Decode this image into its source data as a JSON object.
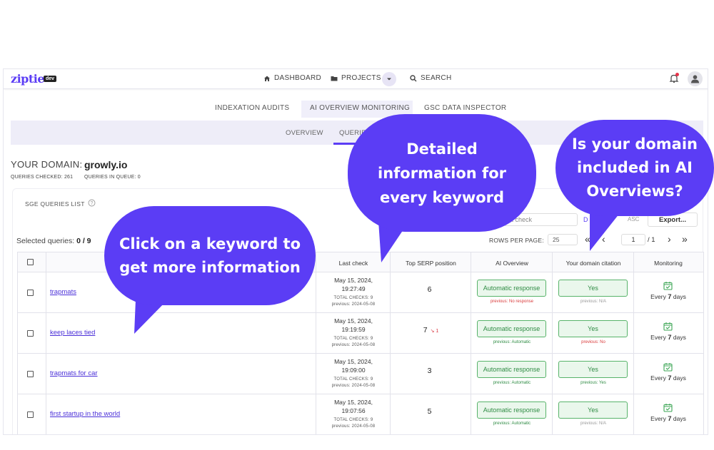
{
  "app": {
    "logo": "ziptie",
    "badge": "dev"
  },
  "topnav": {
    "dashboard": "DASHBOARD",
    "projects": "PROJECTS",
    "search": "SEARCH"
  },
  "tabs": [
    "INDEXATION AUDITS",
    "AI OVERVIEW MONITORING",
    "GSC DATA INSPECTOR"
  ],
  "subtabs": [
    "OVERVIEW",
    "QUERIES"
  ],
  "domain": {
    "label": "YOUR DOMAIN:",
    "value": "growly.io"
  },
  "stats": {
    "checked": "QUERIES CHECKED:  261",
    "queue": "QUERIES IN QUEUE:  0"
  },
  "card": {
    "title": "SGE QUERIES LIST",
    "selected_label": "Selected queries:",
    "selected_value": "0 / 9",
    "sort_value": "st check",
    "desc": "D",
    "asc": "ASC",
    "export": "Export...",
    "rows_per_page_label": "ROWS PER PAGE:",
    "rows_per_page": "25",
    "page": "1",
    "page_total": "/ 1"
  },
  "columns": [
    "Last check",
    "Top SERP position",
    "AI Overview",
    "Your domain citation",
    "Monitoring"
  ],
  "rows": [
    {
      "keyword": "trapmats",
      "date": "May 15, 2024,",
      "time": "19:27:49",
      "checks": "TOTAL CHECKS: 9",
      "prev_date": "previous: 2024-05-08",
      "serp": "6",
      "serp_change": "",
      "ai": "Automatic response",
      "ai_prev": "previous: No response",
      "ai_prev_color": "red",
      "cite": "Yes",
      "cite_prev": "previous: N/A",
      "cite_prev_color": "grey",
      "mon_pre": "Every ",
      "mon_num": "7",
      "mon_post": " days"
    },
    {
      "keyword": "keep laces tied",
      "date": "May 15, 2024,",
      "time": "19:19:59",
      "checks": "TOTAL CHECKS: 9",
      "prev_date": "previous: 2024-05-08",
      "serp": "7",
      "serp_change": "↘ 1",
      "ai": "Automatic response",
      "ai_prev": "previous: Automatic",
      "ai_prev_color": "green",
      "cite": "Yes",
      "cite_prev": "previous: No",
      "cite_prev_color": "red",
      "mon_pre": "Every ",
      "mon_num": "7",
      "mon_post": " days"
    },
    {
      "keyword": "trapmats for car",
      "date": "May 15, 2024,",
      "time": "19:09:00",
      "checks": "TOTAL CHECKS: 9",
      "prev_date": "previous: 2024-05-08",
      "serp": "3",
      "serp_change": "",
      "ai": "Automatic response",
      "ai_prev": "previous: Automatic",
      "ai_prev_color": "green",
      "cite": "Yes",
      "cite_prev": "previous: Yes",
      "cite_prev_color": "green",
      "mon_pre": "Every ",
      "mon_num": "7",
      "mon_post": " days"
    },
    {
      "keyword": "first startup in the world",
      "date": "May 15, 2024,",
      "time": "19:07:56",
      "checks": "TOTAL CHECKS: 9",
      "prev_date": "previous: 2024-05-08",
      "serp": "5",
      "serp_change": "",
      "ai": "Automatic response",
      "ai_prev": "previous: Automatic",
      "ai_prev_color": "green",
      "cite": "Yes",
      "cite_prev": "previous: N/A",
      "cite_prev_color": "grey",
      "mon_pre": "Every ",
      "mon_num": "7",
      "mon_post": " days"
    }
  ],
  "callouts": {
    "left": "Click on a keyword to get more information",
    "middle": "Detailed information for every keyword",
    "right": "Is your domain included in AI Overviews?"
  },
  "colors": {
    "brand": "#5b3df5",
    "success": "#2f8c44",
    "danger": "#d93a3a"
  }
}
